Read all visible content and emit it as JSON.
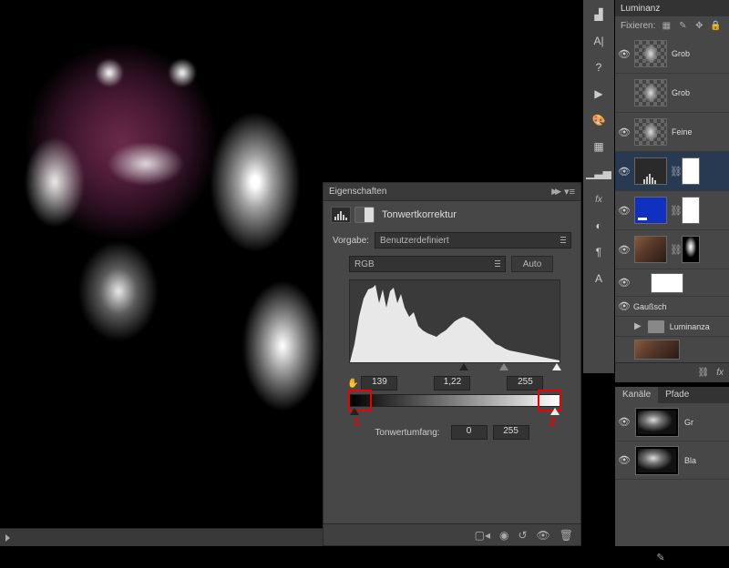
{
  "properties": {
    "panel_title": "Eigenschaften",
    "adjustment_name": "Tonwertkorrektur",
    "preset_label": "Vorgabe:",
    "preset_value": "Benutzerdefiniert",
    "channel_value": "RGB",
    "auto_label": "Auto",
    "input_black": "139",
    "input_gamma": "1,22",
    "input_white": "255",
    "output_label": "Tonwertumfang:",
    "output_black": "0",
    "output_white": "255",
    "marker_1": "1",
    "marker_2": "2"
  },
  "layers": {
    "header": "Luminanz",
    "lock_label": "Fixieren:",
    "items": [
      {
        "name": "Grob"
      },
      {
        "name": "Grob"
      },
      {
        "name": "Feine"
      }
    ],
    "gauss": "Gaußsch",
    "group": "Luminanza"
  },
  "channels": {
    "tab1": "Kanäle",
    "tab2": "Pfade",
    "items": [
      {
        "name": "Gr"
      },
      {
        "name": "Bla"
      }
    ]
  }
}
